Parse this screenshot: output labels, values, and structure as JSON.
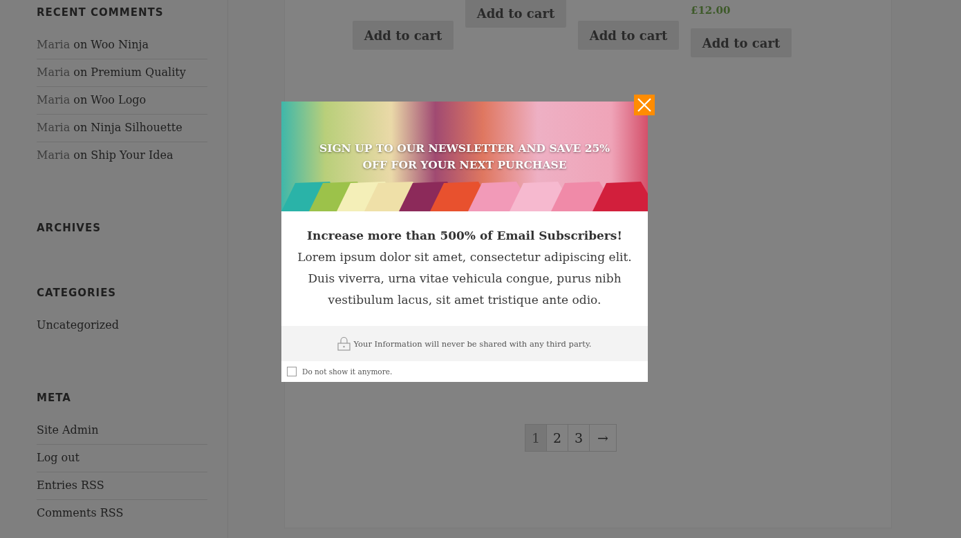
{
  "sidebar": {
    "widgets": [
      {
        "title": "RECENT COMMENTS",
        "items": [
          {
            "author": "Maria",
            "joiner": "on",
            "link": "Woo Ninja"
          },
          {
            "author": "Maria",
            "joiner": "on",
            "link": "Premium Quality"
          },
          {
            "author": "Maria",
            "joiner": "on",
            "link": "Woo Logo"
          },
          {
            "author": "Maria",
            "joiner": "on",
            "link": "Ninja Silhouette"
          },
          {
            "author": "Maria",
            "joiner": "on",
            "link": "Ship Your Idea"
          }
        ]
      },
      {
        "title": "ARCHIVES"
      },
      {
        "title": "CATEGORIES",
        "items": [
          {
            "link": "Uncategorized"
          }
        ]
      },
      {
        "title": "META",
        "items": [
          {
            "link": "Site Admin"
          },
          {
            "link": "Log out"
          },
          {
            "link": "Entries RSS"
          },
          {
            "link": "Comments RSS"
          }
        ]
      }
    ]
  },
  "products": [
    {
      "button": "Add to cart"
    },
    {
      "button": "Add to cart"
    },
    {
      "button": "Add to cart"
    },
    {
      "price": "£12.00",
      "button": "Add to cart"
    }
  ],
  "pagination": [
    {
      "label": "1",
      "selected": true
    },
    {
      "label": "2",
      "selected": false
    },
    {
      "label": "3",
      "selected": false
    },
    {
      "label": "→",
      "selected": false
    }
  ],
  "popup": {
    "headline": "SIGN UP TO OUR NEWSLETTER AND SAVE 25% OFF FOR YOUR NEXT PURCHASE",
    "body": "**Increase more than 500% of Email Subscribers!** Lorem ipsum dolor sit amet, consectetur adipiscing elit. Duis viverra, urna vitae vehicula congue, purus nibh vestibulum lacus, sit amet tristique ante odio.",
    "privacy": "Your Information will never be shared with any third party.",
    "dont_show": {
      "label": "Do not show it anymore.",
      "checked": false
    }
  }
}
